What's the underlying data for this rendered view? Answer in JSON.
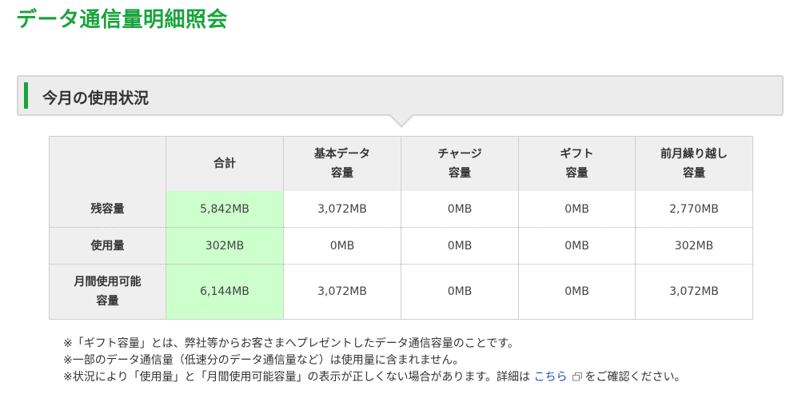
{
  "page": {
    "title": "データ通信量明細照会"
  },
  "section": {
    "title": "今月の使用状況"
  },
  "table": {
    "headers": [
      {
        "line1": "",
        "line2": ""
      },
      {
        "line1": "合計",
        "line2": ""
      },
      {
        "line1": "基本データ",
        "line2": "容量"
      },
      {
        "line1": "チャージ",
        "line2": "容量"
      },
      {
        "line1": "ギフト",
        "line2": "容量"
      },
      {
        "line1": "前月繰り越し",
        "line2": "容量"
      }
    ],
    "rows": [
      {
        "label_line1": "残容量",
        "label_line2": "",
        "values": [
          "5,842MB",
          "3,072MB",
          "0MB",
          "0MB",
          "2,770MB"
        ]
      },
      {
        "label_line1": "使用量",
        "label_line2": "",
        "values": [
          "302MB",
          "0MB",
          "0MB",
          "0MB",
          "302MB"
        ]
      },
      {
        "label_line1": "月間使用可能",
        "label_line2": "容量",
        "values": [
          "6,144MB",
          "3,072MB",
          "0MB",
          "0MB",
          "3,072MB"
        ]
      }
    ]
  },
  "notes": {
    "note1": "※「ギフト容量」とは、弊社等からお客さまへプレゼントしたデータ通信容量のことです。",
    "note2": "※一部のデータ通信量（低速分のデータ通信量など）は使用量に含まれません。",
    "note3_prefix": "※状況により「使用量」と「月間使用可能容量」の表示が正しくない場合があります。詳細は",
    "note3_link": "こちら",
    "note3_suffix": "をご確認ください。"
  },
  "icons": {
    "external_link": "external-link-icon"
  },
  "colors": {
    "accent_green": "#1aa33c",
    "total_highlight": "#ccffcc",
    "header_bg": "#efefef",
    "link_blue": "#1a55b8"
  }
}
